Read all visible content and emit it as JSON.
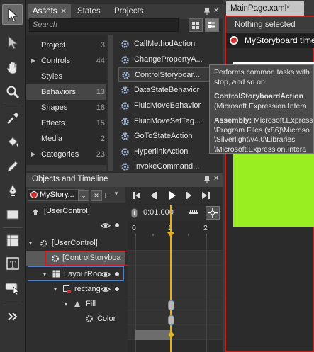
{
  "assets_panel": {
    "tabs": [
      {
        "label": "Assets",
        "active": true,
        "closable": true
      },
      {
        "label": "States",
        "active": false
      },
      {
        "label": "Projects",
        "active": false
      }
    ],
    "pin_icon": "pin-icon",
    "close_icon": "close-icon",
    "search_placeholder": "Search",
    "categories": [
      {
        "label": "Project",
        "count": "3"
      },
      {
        "label": "Controls",
        "count": "44",
        "expandable": true
      },
      {
        "label": "Styles",
        "count": ""
      },
      {
        "label": "Behaviors",
        "count": "13",
        "selected": true
      },
      {
        "label": "Shapes",
        "count": "18"
      },
      {
        "label": "Effects",
        "count": "15"
      },
      {
        "label": "Media",
        "count": "2"
      },
      {
        "label": "Categories",
        "count": "23",
        "expandable": true
      }
    ],
    "behaviors": [
      {
        "label": "CallMethodAction"
      },
      {
        "label": "ChangePropertyA..."
      },
      {
        "label": "ControlStoryboar...",
        "selected": true
      },
      {
        "label": "DataStateBehavior"
      },
      {
        "label": "FluidMoveBehavior"
      },
      {
        "label": "FluidMoveSetTag..."
      },
      {
        "label": "GoToStateAction"
      },
      {
        "label": "HyperlinkAction"
      },
      {
        "label": "InvokeCommand..."
      }
    ]
  },
  "tooltip": {
    "line1": "Performs common tasks with",
    "line2": "stop, and so on.",
    "name": "ControlStoryboardAction",
    "namespace": "(Microsoft.Expression.Intera",
    "assembly_label": "Assembly:",
    "assembly_value": "Microsoft.Express",
    "path1": "\\Program Files (x86)\\Microso",
    "path2": "\\Silverlight\\v4.0\\Libraries",
    "path3": "\\Microsoft.Expression.Intera"
  },
  "document": {
    "tab_label": "MainPage.xaml*",
    "selection_label": "Nothing selected",
    "storyboard_label": "MyStoryboard timeline",
    "colors": {
      "canvas": "#ffffff",
      "rectangle": "#99ee22",
      "recording": "#d42f2f"
    }
  },
  "objects_timeline": {
    "title": "Objects and Timeline",
    "storyboard_name": "MyStory...",
    "close_storyboard": "✕",
    "add_storyboard": "+",
    "playback": [
      "first-frame-icon",
      "prev-frame-icon",
      "play-icon",
      "next-frame-icon",
      "last-frame-icon"
    ],
    "time": "0:01.000",
    "ruler": [
      "0",
      "1",
      "2"
    ],
    "tree": [
      {
        "label": "[UserControl]",
        "level": 0
      },
      {
        "label": "[UserControl]",
        "level": 0
      },
      {
        "label": "[ControlStoryboa",
        "level": 1,
        "selected": true
      },
      {
        "label": "LayoutRoot",
        "level": 1
      },
      {
        "label": "rectangle",
        "level": 2
      },
      {
        "label": "Fill",
        "level": 3
      },
      {
        "label": "Color",
        "level": 4
      }
    ]
  }
}
